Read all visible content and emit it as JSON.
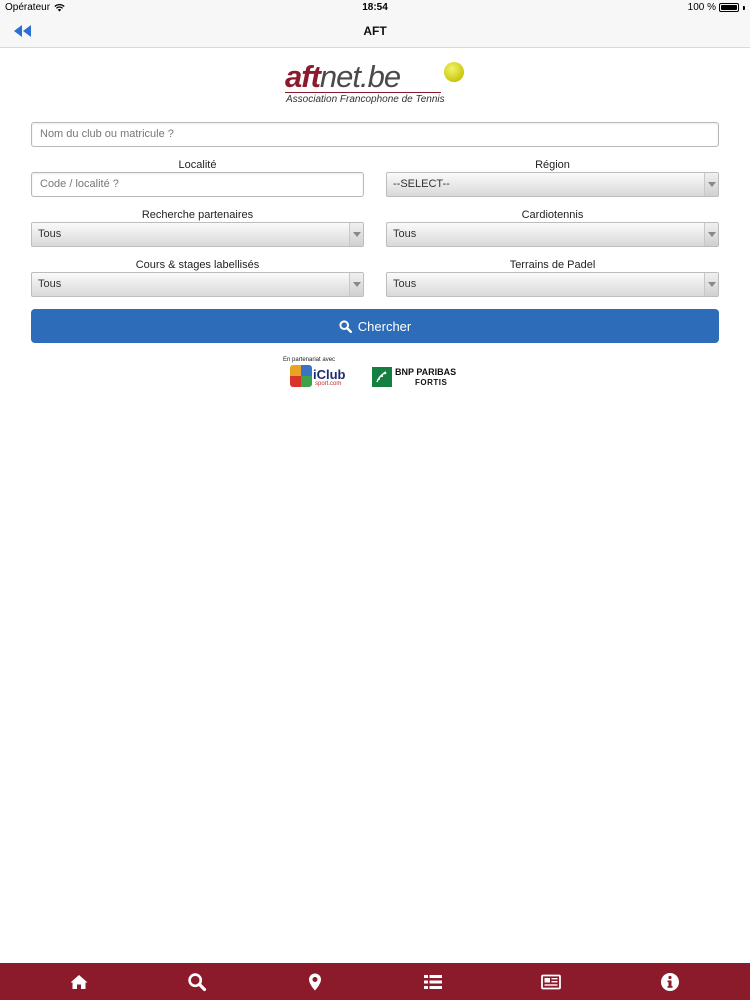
{
  "status_bar": {
    "carrier": "Opérateur",
    "time": "18:54",
    "battery": "100 %"
  },
  "nav": {
    "title": "AFT"
  },
  "logo": {
    "brand_aft": "aft",
    "brand_rest": "net.be",
    "subtitle": "Association Francophone de Tennis"
  },
  "form": {
    "club_placeholder": "Nom du club ou matricule ?",
    "localite_label": "Localité",
    "localite_placeholder": "Code / localité ?",
    "region_label": "Région",
    "region_value": "--SELECT--",
    "partenaires_label": "Recherche partenaires",
    "partenaires_value": "Tous",
    "cardio_label": "Cardiotennis",
    "cardio_value": "Tous",
    "cours_label": "Cours & stages labellisés",
    "cours_value": "Tous",
    "padel_label": "Terrains de Padel",
    "padel_value": "Tous",
    "search_label": "Chercher"
  },
  "partners": {
    "caption": "En partenariat avec",
    "iclub_name": "iClub",
    "iclub_sub": "sport.com",
    "bnp_line1": "BNP PARIBAS",
    "bnp_line2": "FORTIS"
  },
  "tabs": [
    "home-icon",
    "search-icon",
    "map-pin-icon",
    "list-icon",
    "news-icon",
    "info-icon"
  ],
  "colors": {
    "brand": "#8b1a2b",
    "button": "#2c6cb8",
    "nav_back": "#2a6fd1"
  }
}
